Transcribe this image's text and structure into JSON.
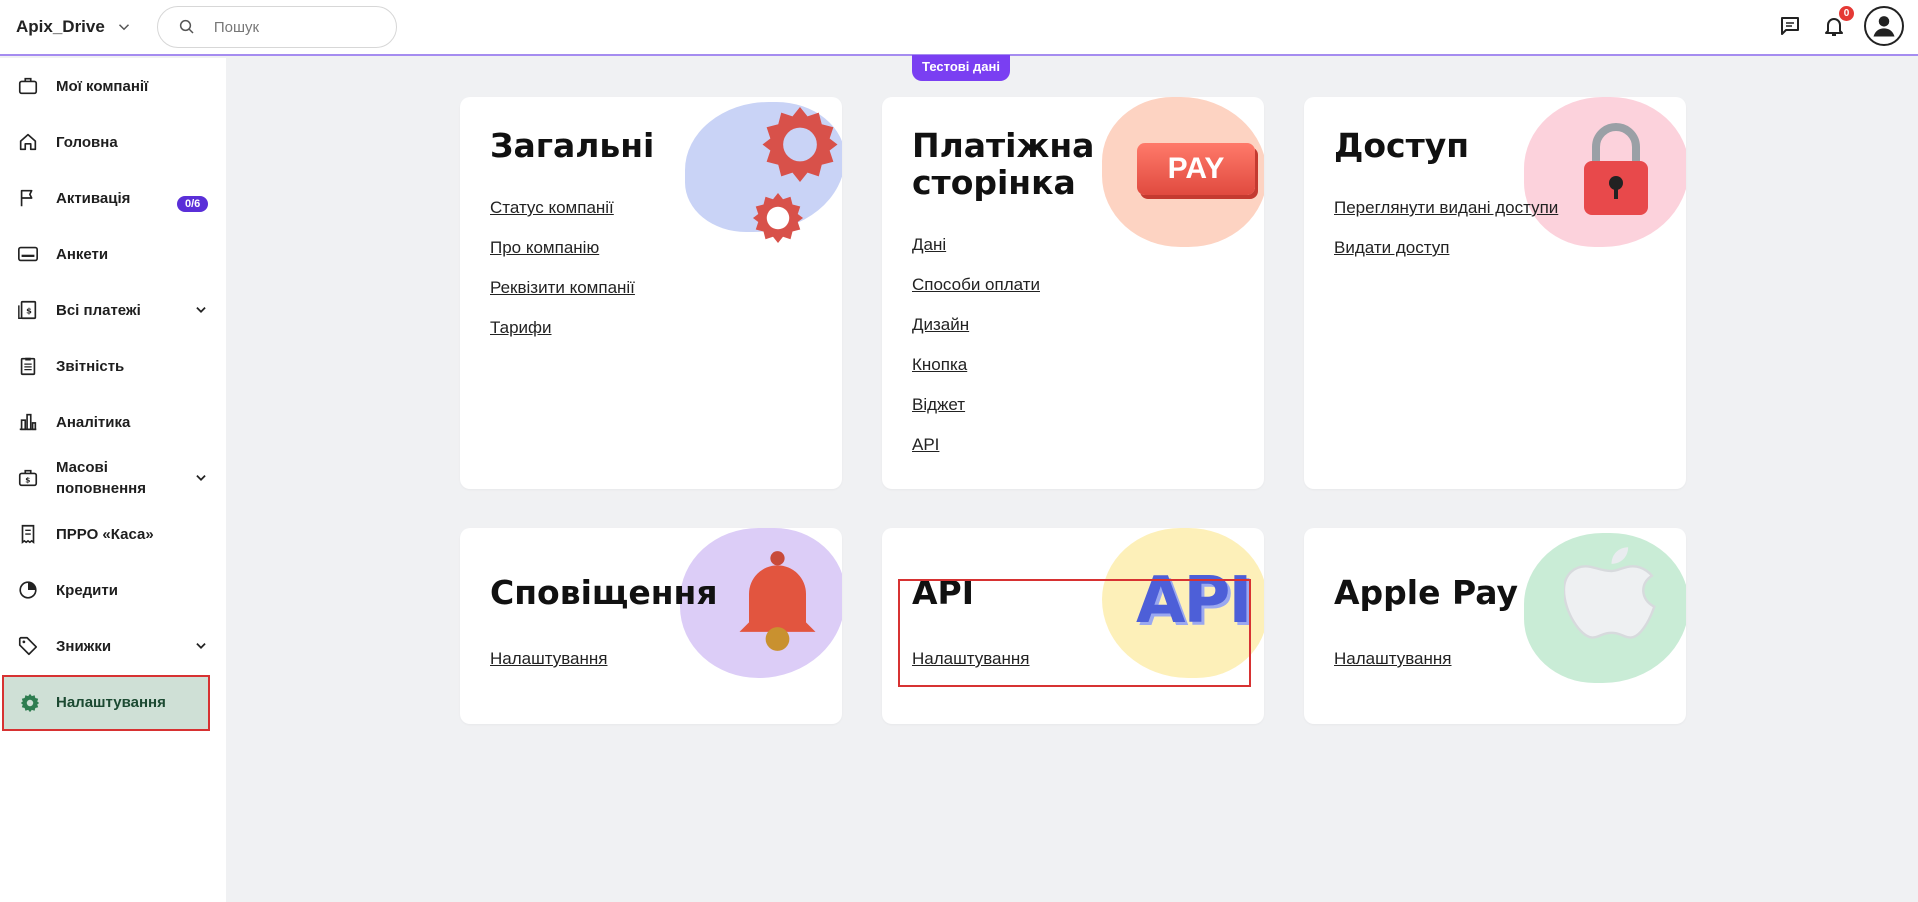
{
  "topbar": {
    "brand": "Apix_Drive",
    "search_placeholder": "Пошук",
    "notifications_count": "0"
  },
  "test_badge": "Тестові дані",
  "sidebar": {
    "items": [
      {
        "label": "Мої компанії",
        "icon": "briefcase-icon"
      },
      {
        "label": "Головна",
        "icon": "home-icon"
      },
      {
        "label": "Активація",
        "icon": "flag-icon",
        "badge": "0/6"
      },
      {
        "label": "Анкети",
        "icon": "id-card-icon"
      },
      {
        "label": "Всі платежі",
        "icon": "payments-icon",
        "expandable": true
      },
      {
        "label": "Звітність",
        "icon": "clipboard-icon"
      },
      {
        "label": "Аналітика",
        "icon": "bar-chart-icon"
      },
      {
        "label": "Масові поповнення",
        "icon": "wallet-icon",
        "expandable": true
      },
      {
        "label": "ПРРО «Каса»",
        "icon": "receipt-icon"
      },
      {
        "label": "Кредити",
        "icon": "pie-chart-icon"
      },
      {
        "label": "Знижки",
        "icon": "tag-icon",
        "expandable": true
      },
      {
        "label": "Налаштування",
        "icon": "gear-icon",
        "active": true
      }
    ]
  },
  "cards": [
    {
      "title": "Загальні",
      "links": [
        "Статус компанії",
        "Про компанію",
        "Реквізити компанії",
        "Тарифи"
      ]
    },
    {
      "title_line1": "Платіжна",
      "title_line2": "сторінка",
      "badge": "PAY",
      "links": [
        "Дані",
        "Способи оплати",
        "Дизайн",
        "Кнопка",
        "Віджет",
        "API"
      ]
    },
    {
      "title": "Доступ",
      "links": [
        "Переглянути видані доступи",
        "Видати доступ"
      ]
    },
    {
      "title": "Сповіщення",
      "links": [
        "Налаштування"
      ]
    },
    {
      "title": "API",
      "art_text": "API",
      "links": [
        "Налаштування"
      ]
    },
    {
      "title": "Apple Pay",
      "links": [
        "Налаштування"
      ]
    }
  ],
  "colors": {
    "accent": "#7a3ff2",
    "active_bg": "#cfe0d6",
    "highlight_border": "#d73232"
  }
}
